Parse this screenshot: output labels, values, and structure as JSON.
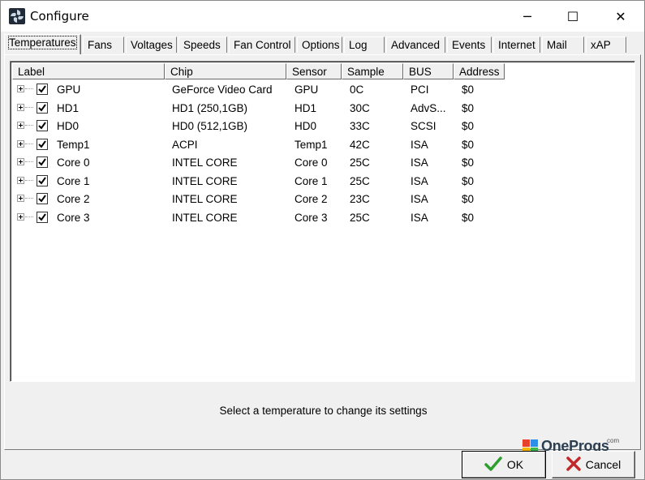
{
  "window": {
    "title": "Configure",
    "icon": "fan-blade-icon",
    "controls": {
      "minimize": "─",
      "maximize": "☐",
      "close": "✕"
    }
  },
  "tabs": [
    {
      "label": "Temperatures",
      "active": true
    },
    {
      "label": "Fans"
    },
    {
      "label": "Voltages"
    },
    {
      "label": "Speeds"
    },
    {
      "label": "Fan Control"
    },
    {
      "label": "Options"
    },
    {
      "label": "Log"
    },
    {
      "label": "Advanced"
    },
    {
      "label": "Events"
    },
    {
      "label": "Internet"
    },
    {
      "label": "Mail"
    },
    {
      "label": "xAP"
    }
  ],
  "table": {
    "columns": [
      "Label",
      "Chip",
      "Sensor",
      "Sample",
      "BUS",
      "Address"
    ],
    "rows": [
      {
        "label": "GPU",
        "chip": "GeForce Video Card",
        "sensor": "GPU",
        "sample": "0C",
        "bus": "PCI",
        "address": "$0",
        "checked": true
      },
      {
        "label": "HD1",
        "chip": "HD1 (250,1GB)",
        "sensor": "HD1",
        "sample": "30C",
        "bus": "AdvS...",
        "address": "$0",
        "checked": true
      },
      {
        "label": "HD0",
        "chip": "HD0 (512,1GB)",
        "sensor": "HD0",
        "sample": "33C",
        "bus": "SCSI",
        "address": "$0",
        "checked": true
      },
      {
        "label": "Temp1",
        "chip": "ACPI",
        "sensor": "Temp1",
        "sample": "42C",
        "bus": "ISA",
        "address": "$0",
        "checked": true
      },
      {
        "label": "Core 0",
        "chip": "INTEL CORE",
        "sensor": "Core 0",
        "sample": "25C",
        "bus": "ISA",
        "address": "$0",
        "checked": true
      },
      {
        "label": "Core 1",
        "chip": "INTEL CORE",
        "sensor": "Core 1",
        "sample": "25C",
        "bus": "ISA",
        "address": "$0",
        "checked": true
      },
      {
        "label": "Core 2",
        "chip": "INTEL CORE",
        "sensor": "Core 2",
        "sample": "23C",
        "bus": "ISA",
        "address": "$0",
        "checked": true
      },
      {
        "label": "Core 3",
        "chip": "INTEL CORE",
        "sensor": "Core 3",
        "sample": "25C",
        "bus": "ISA",
        "address": "$0",
        "checked": true
      }
    ]
  },
  "status_text": "Select a temperature to change its settings",
  "watermark": {
    "text": "OneProgs",
    "suffix": "com"
  },
  "buttons": {
    "ok": {
      "label": "OK",
      "icon": "checkmark-icon",
      "color": "#2e9e2e"
    },
    "cancel": {
      "label": "Cancel",
      "icon": "x-cross-icon",
      "color": "#c0282a"
    }
  }
}
